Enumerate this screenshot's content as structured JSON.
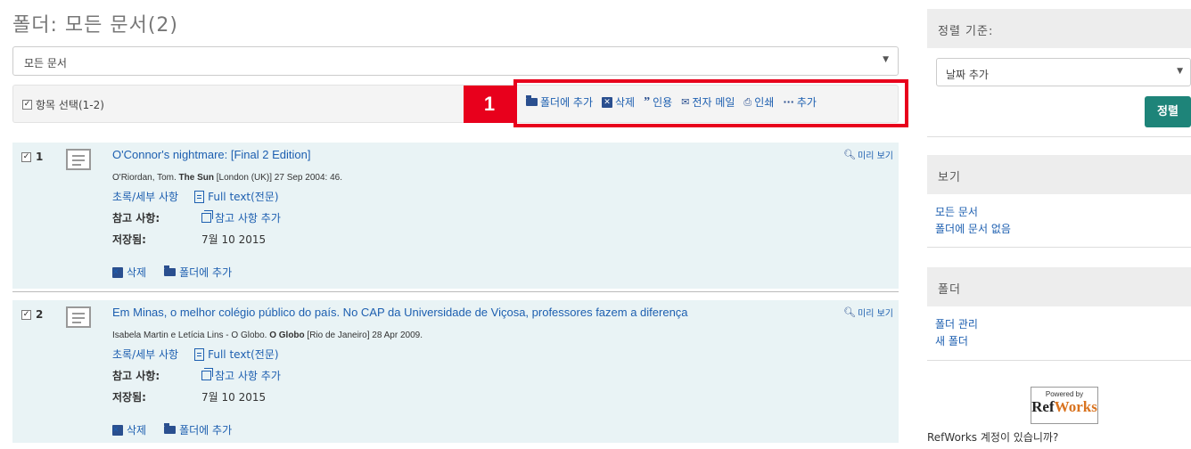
{
  "page": {
    "title": "폴더: 모든 문서(2)"
  },
  "filter": {
    "value": "모든 문서",
    "arrow": "▼"
  },
  "toolbar": {
    "select_all": "항목 선택(1-2)",
    "marker": "1",
    "actions": {
      "add_folder": "폴더에 추가",
      "delete": "삭제",
      "cite": "인용",
      "email": "전자 메일",
      "print": "인쇄",
      "more": "추가"
    }
  },
  "results": [
    {
      "num": "1",
      "title": "O'Connor's nightmare: [Final 2 Edition]",
      "cite_pre": "O'Riordan, Tom. ",
      "cite_source": "The Sun",
      "cite_post": " [London (UK)] 27 Sep 2004: 46.",
      "abstract_link": "초록/세부 사항",
      "fulltext_link": "Full text(전문)",
      "note_label": "참고 사항:",
      "note_add": "참고 사항 추가",
      "saved_label": "저장됨:",
      "saved_value": "7월 10 2015",
      "delete": "삭제",
      "add_folder": "폴더에 추가",
      "preview": "미리 보기"
    },
    {
      "num": "2",
      "title": "Em Minas, o melhor colégio público do país. No CAP da Universidade de Viçosa, professores fazem a diferença",
      "cite_pre": "Isabela Martin e Letícia Lins - O Globo. ",
      "cite_source": "O Globo",
      "cite_post": " [Rio de Janeiro] 28 Apr 2009.",
      "abstract_link": "초록/세부 사항",
      "fulltext_link": "Full text(전문)",
      "note_label": "참고 사항:",
      "note_add": "참고 사항 추가",
      "saved_label": "저장됨:",
      "saved_value": "7월 10 2015",
      "delete": "삭제",
      "add_folder": "폴더에 추가",
      "preview": "미리 보기"
    }
  ],
  "sidebar": {
    "sort_heading": "정렬 기준:",
    "sort_value": "날짜 추가",
    "sort_button": "정렬",
    "view_heading": "보기",
    "view_links": [
      "모든 문서",
      "폴더에 문서 없음"
    ],
    "folder_heading": "폴더",
    "folder_links": [
      "폴더 관리",
      "새 폴더"
    ],
    "powered_by": "Powered by",
    "refworks_ref": "Ref",
    "refworks_works": "Works",
    "refworks_question": "RefWorks 계정이 있습니까?"
  },
  "colors": {
    "accent": "#1d5fb0",
    "highlight": "#e8001c",
    "button": "#1e8479",
    "result_bg": "#e9f3f5"
  }
}
